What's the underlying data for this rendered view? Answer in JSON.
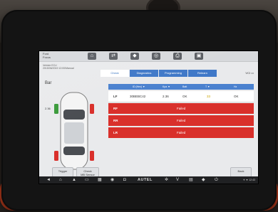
{
  "header": {
    "title_line1": "Ford",
    "title_line2": "Focus",
    "crumb_line1": "Vehicle ECU",
    "crumb_line2": "2015/06/2019 12:00/Manual"
  },
  "toolbar": {
    "icons": [
      "home-icon",
      "swap-icon",
      "car-icon",
      "steering-icon",
      "print-icon",
      "message-icon"
    ],
    "glyphs": [
      "⌂",
      "⇄",
      "🚗",
      "◎",
      "⎙",
      "▣"
    ]
  },
  "tabs": [
    {
      "label": "Check",
      "active": true
    },
    {
      "label": "Diagnostics",
      "active": false
    },
    {
      "label": "Programming",
      "active": false
    },
    {
      "label": "Relearn",
      "active": false
    }
  ],
  "right_info": "VCI",
  "tire_section_label": "Bar",
  "car_left_value": "2.36",
  "table": {
    "headers": [
      "ID (Hex) ▼",
      "Kpa ▼",
      "Batt",
      "T ▼",
      "Hz"
    ],
    "rows": [
      {
        "position": "LF",
        "status": "ok",
        "id": "30BEBC42",
        "pressure": "2.36",
        "battery": "OK",
        "temp": "33",
        "freq": "OK"
      },
      {
        "position": "RF",
        "status": "fail",
        "message": "Failed"
      },
      {
        "position": "RR",
        "status": "fail",
        "message": "Failed"
      },
      {
        "position": "LR",
        "status": "fail",
        "message": "Failed"
      }
    ]
  },
  "buttons": {
    "trigger": "Trigger",
    "check_line1": "Check",
    "check_line2": "MB Sensor",
    "back": "Back"
  },
  "sysbar": {
    "icons": [
      "back-icon",
      "home-icon",
      "car-icon",
      "window-icon",
      "grid-icon",
      "chrome-icon",
      "camera-icon",
      "settings-icon",
      "vci-icon",
      "bus-icon",
      "car-service-icon",
      "power-icon"
    ],
    "brand": "AUTEL",
    "status": "✈ ▼ 12:43"
  },
  "colors": {
    "accent": "#3f78c8",
    "fail": "#d9302b",
    "bumper": "#b63a1c"
  }
}
